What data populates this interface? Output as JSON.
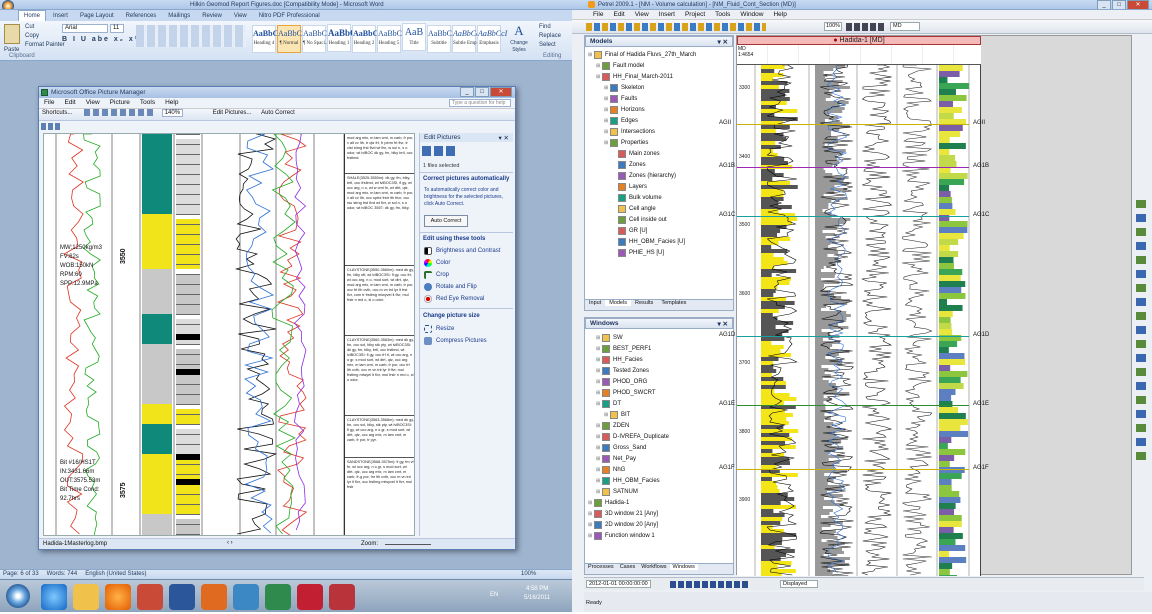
{
  "word": {
    "title": "Hilkin Geomod Report Figures.doc [Compatibility Mode] - Microsoft Word",
    "tabs": [
      "Home",
      "Insert",
      "Page Layout",
      "References",
      "Mailings",
      "Review",
      "View",
      "Nitro PDF Professional"
    ],
    "clipboard": {
      "cut": "Cut",
      "copy": "Copy",
      "paste": "Paste",
      "format_painter": "Format Painter",
      "group": "Clipboard"
    },
    "font_name": "Arial",
    "font_size": "11",
    "styles": [
      {
        "preview": "AaBbC",
        "label": "Heading 4"
      },
      {
        "preview": "AaBbCcI",
        "label": "¶ Normal"
      },
      {
        "preview": "AaBbCcI",
        "label": "¶ No Spaci..."
      },
      {
        "preview": "AaBbC",
        "label": "Heading 1"
      },
      {
        "preview": "AaBbC",
        "label": "Heading 2"
      },
      {
        "preview": "AaBbCc",
        "label": "Heading 5"
      },
      {
        "preview": "AaB",
        "label": "Title"
      },
      {
        "preview": "AaBbCcI",
        "label": "Subtitle"
      },
      {
        "preview": "AaBbCcI",
        "label": "Subtle Emp..."
      },
      {
        "preview": "AaBbCcI",
        "label": "Emphasis"
      }
    ],
    "change_styles": "Change Styles",
    "editing": {
      "find": "Find",
      "replace": "Replace",
      "select": "Select",
      "group": "Editing"
    },
    "status": {
      "page": "Page: 6 of 33",
      "words": "Words: 744",
      "language": "English (United States)",
      "zoom": "100%"
    }
  },
  "picture_manager": {
    "title": "Microsoft Office Picture Manager",
    "menu": [
      "File",
      "Edit",
      "View",
      "Picture",
      "Tools",
      "Help"
    ],
    "help_placeholder": "Type a question for help",
    "toolbar": {
      "shortcuts": "Shortcuts...",
      "zoom": "140%",
      "edit_pictures": "Edit Pictures...",
      "auto_correct": "Auto Correct"
    },
    "filename": "Hadida-1Masterlog.bmp",
    "zoom_label": "Zoom:",
    "side": {
      "title": "Edit Pictures",
      "files_selected": "1 files selected",
      "correct_header": "Correct pictures automatically",
      "correct_text": "To automatically correct color and brightness for the selected pictures, click Auto Correct.",
      "auto_correct_btn": "Auto Correct",
      "tools_header": "Edit using these tools",
      "tools": [
        "Brightness and Contrast",
        "Color",
        "Crop",
        "Rotate and Flip",
        "Red Eye Removal"
      ],
      "size_header": "Change picture size",
      "size_tools": [
        "Resize",
        "Compress Pictures"
      ]
    },
    "log": {
      "depth1": "3550",
      "depth2": "3575",
      "depth3": "3550",
      "drill_params": [
        "MW:1250kg/m3",
        "FV:62s",
        "WOB:150kN",
        "RPM:60",
        "SPP:12.9MPa"
      ],
      "bit_info": [
        "Bit #16/HS1T",
        "IN:3431.66m",
        "OUT:3575.53m",
        "Bit Time Cond:",
        "92.7hrs"
      ],
      "descriptions": [
        "mod arg mtx, m lam cmt, m carb, fr por, v alt cv lth, tr qtz frt, fr perm frt flvr, tr clst strng frst flvd wt flvr, w sol n, s o odor, wt lvlBOC dk gy, fm, blky brtl, occ frstlmd.",
        "SHALE(3525-3550m): dk gy, fm, blky, brtl, occ frstlmd, wt lvlBOC3SI, fl gy, wl occ arg, n o, wt w cmt fn, wt dtrt, qtz, mod arg mtx, m lam cmt, m carb, fr por, v alt cv lth, occ sptrd frstr lth fncr, occ rsu strng frst flvd wt flvr, w sol n, s o odor, wt lvlBOC 3557: dk gy, fm, blky.",
        "CLAYSTONE(3550-3560m): med dk gy, fm, blky sft, wt lvlBOC3SI: fl gy, occ frt, wl occ arg, n o, mod sort, wt dtrt, qtz, mod arg mtx, m lam cmt, m carb, fr por, occ frt lth cvth, occ m vn tnt lyr lt frst flvr, com tr frstlmg mlwyvel lt flvr, mul frstr n red o, sl o odor.",
        "CLAYSTONE(3560-3563m): med dk gy, fm, occ sol, blky stk pty, wt lvlBOC3SI: dk gy, fm, blky, brtl, occ frstlmd, wt lvlBOC3SI: fl gy, occ frt lt, wl occ arg, n o gr, s mod sort, wt dtrt, qtz, occ arg mtx, m lam cmt, m carb, fr por, occ frt lth cvth, occ m vn tnt lyr lt flvr, mul frstlmg mlwyel lt flvr, mul frstr n red o, sl o odor.",
        "CLAYSTONE(3563-3568m): med dk gy, fm, occ sol, blky, stk pty, wt lvlBOC3SI: fl gy, wl occ arg, n o gr, s mod sort, wt dtrt, qtz, occ arg mtx, m lam cmt, m carb, fr por, tr pyr.",
        "SANDSTONE(3568-3575m): lt gy, fm vf fn, wl occ arg, n o gr, s mod sort, wt dtrt, qtz, occ arg mtx, m lam cmt, m carb, fr-g por, fnr lth cvth, occ m vn tnt lyr lt flvr, occ frstlmg mlwyvel lt flvr, mul frstr"
      ]
    }
  },
  "petrel": {
    "title": "Petrel 2009.1 - [NM - Volume calculation] - [NM_Fluid_Cont_Section (MD)]",
    "menu": [
      "File",
      "Edit",
      "View",
      "Insert",
      "Project",
      "Tools",
      "Window",
      "Help"
    ],
    "zoom": "100%",
    "md_field": "MD",
    "models_panel": {
      "title": "Models",
      "items": [
        {
          "label": "Final of Hadida Fluvs_27th_March",
          "indent": 0
        },
        {
          "label": "Fault model",
          "indent": 1
        },
        {
          "label": "HH_Final_March-2011",
          "indent": 1
        },
        {
          "label": "Skeleton",
          "indent": 2
        },
        {
          "label": "Faults",
          "indent": 2
        },
        {
          "label": "Horizons",
          "indent": 2
        },
        {
          "label": "Edges",
          "indent": 2
        },
        {
          "label": "Intersections",
          "indent": 2
        },
        {
          "label": "Properties",
          "indent": 2
        },
        {
          "label": "Main zones",
          "indent": 3
        },
        {
          "label": "Zones",
          "indent": 3
        },
        {
          "label": "Zones (hierarchy)",
          "indent": 3
        },
        {
          "label": "Layers",
          "indent": 3
        },
        {
          "label": "Bulk volume",
          "indent": 3
        },
        {
          "label": "Cell angle",
          "indent": 3
        },
        {
          "label": "Cell inside out",
          "indent": 3
        },
        {
          "label": "GR [U]",
          "indent": 3
        },
        {
          "label": "HH_OBM_Facies [U]",
          "indent": 3
        },
        {
          "label": "PHIE_HS [U]",
          "indent": 3
        }
      ],
      "tabs": [
        "Input",
        "Models",
        "Results",
        "Templates"
      ]
    },
    "windows_panel": {
      "title": "Windows",
      "items": [
        {
          "label": "SW",
          "indent": 1
        },
        {
          "label": "BEST_PERF1",
          "indent": 1
        },
        {
          "label": "HH_Facies",
          "indent": 1
        },
        {
          "label": "Tested Zones",
          "indent": 1
        },
        {
          "label": "PHOD_ORG",
          "indent": 1
        },
        {
          "label": "PHOD_SWCRT",
          "indent": 1
        },
        {
          "label": "DT",
          "indent": 1
        },
        {
          "label": "BIT",
          "indent": 2
        },
        {
          "label": "ZDEN",
          "indent": 1
        },
        {
          "label": "D-IVREFA_Duplicate",
          "indent": 1
        },
        {
          "label": "Gross_Sand",
          "indent": 1
        },
        {
          "label": "Net_Pay",
          "indent": 1
        },
        {
          "label": "NhG",
          "indent": 1
        },
        {
          "label": "HH_OBM_Facies",
          "indent": 1
        },
        {
          "label": "SATNUM",
          "indent": 1
        },
        {
          "label": "Hadida-1",
          "indent": 0
        },
        {
          "label": "3D window 21 [Any]",
          "indent": 0
        },
        {
          "label": "2D window 20 [Any]",
          "indent": 0
        },
        {
          "label": "Function window 1",
          "indent": 0
        }
      ],
      "tabs": [
        "Processes",
        "Cases",
        "Workflows",
        "Windows"
      ]
    },
    "well": {
      "name": "Hadida-1 [MD]",
      "header_rows": [
        "MD",
        "1:4654"
      ],
      "depths": [
        "3300",
        "3400",
        "3500",
        "3600",
        "3700",
        "3800",
        "3900"
      ],
      "markers": [
        {
          "name": "AGII",
          "depth_frac": 0.115,
          "color": "#c8b400"
        },
        {
          "name": "AG1B",
          "depth_frac": 0.2,
          "color": "#9c27b0"
        },
        {
          "name": "AG1C",
          "depth_frac": 0.295,
          "color": "#17a0a0"
        },
        {
          "name": "AG1D",
          "depth_frac": 0.53,
          "color": "#17a0a0"
        },
        {
          "name": "AG1E",
          "depth_frac": 0.665,
          "color": "#2e8b2e"
        },
        {
          "name": "AG1F",
          "depth_frac": 0.79,
          "color": "#c8b400"
        }
      ],
      "bottom_depth": "3900"
    },
    "status": {
      "datetime": "2012-01-01 00:00:00:00",
      "displayed": "Displayed",
      "ready": "Ready"
    }
  },
  "taskbar": {
    "time": "4:58 PM",
    "date": "5/16/2011",
    "lang": "EN"
  },
  "colors": {
    "accent": "#2b579a",
    "petrel_header": "#f4b9b9",
    "well_bg": "#ffffff",
    "taskbar": "#9cb0c7"
  }
}
